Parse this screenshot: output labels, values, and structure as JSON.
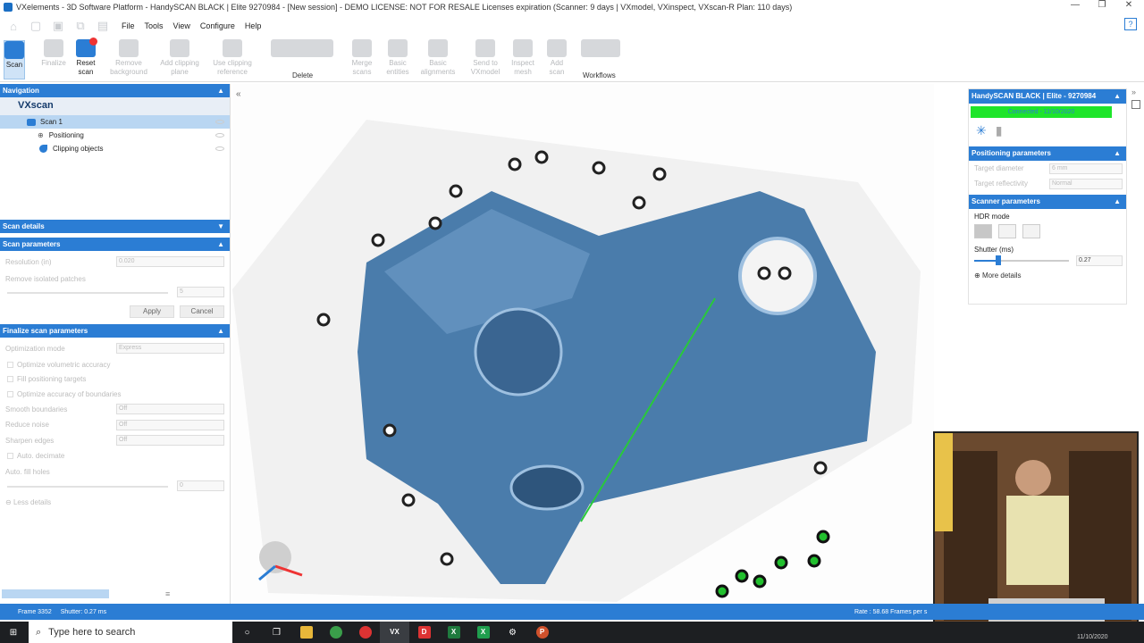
{
  "window": {
    "title": "VXelements - 3D Software Platform - HandySCAN BLACK | Elite 9270984 - [New session] - DEMO LICENSE: NOT FOR RESALE Licenses expiration (Scanner: 9 days | VXmodel, VXinspect, VXscan-R Plan: 110 days)",
    "minimize": "—",
    "restore": "❐",
    "close": "✕"
  },
  "menu": {
    "file": "File",
    "tools": "Tools",
    "view": "View",
    "configure": "Configure",
    "help": "Help"
  },
  "ribbon": {
    "scan": "Scan",
    "finalize": "Finalize",
    "reset_scan": "Reset scan",
    "remove_background": "Remove background",
    "add_clipping_plane": "Add clipping plane",
    "use_clipping_reference": "Use clipping reference",
    "delete_group": "Delete",
    "merge_scans": "Merge scans",
    "basic_entities": "Basic entities",
    "basic_alignments": "Basic alignments",
    "send_to_vxmodel": "Send to VXmodel",
    "inspect_mesh": "Inspect mesh",
    "add_scan": "Add scan",
    "workflows_group": "Workflows"
  },
  "navigation": {
    "header": "Navigation",
    "root": "VXscan",
    "items": [
      {
        "label": "Scan 1"
      },
      {
        "label": "Positioning"
      },
      {
        "label": "Clipping objects"
      }
    ]
  },
  "scan_details": {
    "header": "Scan details"
  },
  "scan_parameters": {
    "header": "Scan parameters",
    "resolution_label": "Resolution (in)",
    "resolution_value": "0.020",
    "remove_isolated_label": "Remove isolated patches",
    "remove_isolated_value": "5",
    "apply": "Apply",
    "cancel": "Cancel"
  },
  "finalize_parameters": {
    "header": "Finalize scan parameters",
    "optimization_mode_label": "Optimization mode",
    "optimization_mode_value": "Express",
    "opt_volumetric": "Optimize volumetric accuracy",
    "fill_targets": "Fill positioning targets",
    "opt_boundaries": "Optimize accuracy of boundaries",
    "smooth_label": "Smooth boundaries",
    "smooth_value": "Off",
    "reduce_label": "Reduce noise",
    "reduce_value": "Off",
    "sharpen_label": "Sharpen edges",
    "sharpen_value": "Off",
    "auto_decimate": "Auto. decimate",
    "auto_fill_label": "Auto. fill holes",
    "auto_fill_value": "0",
    "less_details": "Less details"
  },
  "scanner_panel": {
    "header": "HandySCAN BLACK | Elite - 9270984",
    "connected": "Connected - 11/10/2020",
    "positioning_header": "Positioning parameters",
    "target_diameter_label": "Target diameter",
    "target_diameter_value": "6 mm",
    "target_reflectivity_label": "Target reflectivity",
    "target_reflectivity_value": "Normal",
    "scanner_header": "Scanner parameters",
    "hdr_mode_label": "HDR mode",
    "shutter_label": "Shutter (ms)",
    "shutter_value": "0.27",
    "more_details": "More details"
  },
  "statusbar": {
    "frame": "Frame 3352",
    "shutter": "Shutter: 0.27 ms",
    "rate": "Rate : 58.68 Frames per s"
  },
  "taskbar": {
    "search_placeholder": "Type here to search",
    "date": "11/10/2020"
  }
}
